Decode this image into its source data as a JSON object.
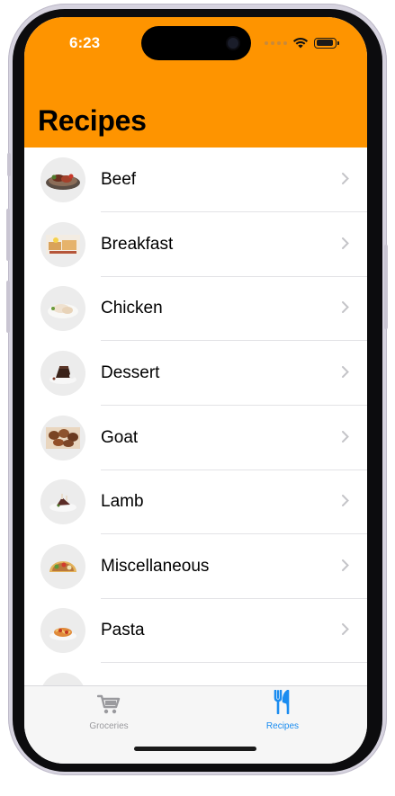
{
  "status_bar": {
    "time": "6:23"
  },
  "header": {
    "title": "Recipes"
  },
  "categories": [
    {
      "label": "Beef",
      "icon": "beef-dish-icon"
    },
    {
      "label": "Breakfast",
      "icon": "breakfast-dish-icon"
    },
    {
      "label": "Chicken",
      "icon": "chicken-dish-icon"
    },
    {
      "label": "Dessert",
      "icon": "dessert-dish-icon"
    },
    {
      "label": "Goat",
      "icon": "goat-dish-icon"
    },
    {
      "label": "Lamb",
      "icon": "lamb-dish-icon"
    },
    {
      "label": "Miscellaneous",
      "icon": "miscellaneous-dish-icon"
    },
    {
      "label": "Pasta",
      "icon": "pasta-dish-icon"
    }
  ],
  "tabs": [
    {
      "label": "Groceries",
      "icon": "cart-icon",
      "selected": false
    },
    {
      "label": "Recipes",
      "icon": "fork-knife-icon",
      "selected": true
    }
  ],
  "colors": {
    "header": "#fe9400",
    "tab_selected": "#1a8cf0",
    "tab_unselected": "#9a9a9e",
    "chevron": "#c4c4c8"
  }
}
